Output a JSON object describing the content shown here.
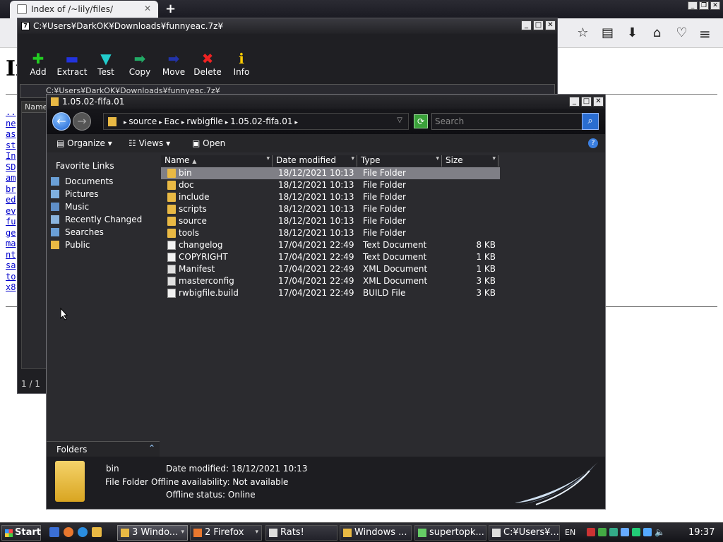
{
  "firefox": {
    "tab_title": "Index of /~lily/files/",
    "heading": "In",
    "links": [
      "..",
      "ne",
      "as",
      "st",
      "In",
      "SD",
      "am",
      "br",
      "ed",
      "ev",
      "fu",
      "ge",
      "ma",
      "nt",
      "sa",
      "to",
      "x8"
    ]
  },
  "zip": {
    "title": "C:¥Users¥DarkOK¥Downloads¥funnyeac.7z¥",
    "toolbar": [
      {
        "label": "Add",
        "icon": "plus-icon",
        "color": "#22cc22"
      },
      {
        "label": "Extract",
        "icon": "minus-icon",
        "color": "#2233dd"
      },
      {
        "label": "Test",
        "icon": "check-icon",
        "color": "#22cccc"
      },
      {
        "label": "Copy",
        "icon": "copy-arrow-icon",
        "color": "#22aa66"
      },
      {
        "label": "Move",
        "icon": "move-arrow-icon",
        "color": "#2233aa"
      },
      {
        "label": "Delete",
        "icon": "delete-x-icon",
        "color": "#ee2222"
      },
      {
        "label": "Info",
        "icon": "info-icon",
        "color": "#ffcc00"
      }
    ],
    "address": "C:¥Users¥DarkOK¥Downloads¥funnyeac.7z¥",
    "col_name": "Name",
    "status": "1 / 1"
  },
  "explorer": {
    "title": "1.05.02-fifa.01",
    "breadcrumb": [
      "source",
      "Eac",
      "rwbigfile",
      "1.05.02-fifa.01"
    ],
    "search_placeholder": "Search",
    "commands": {
      "organize": "Organize",
      "views": "Views",
      "open": "Open"
    },
    "favorites_title": "Favorite Links",
    "favorites": [
      "Documents",
      "Pictures",
      "Music",
      "Recently Changed",
      "Searches",
      "Public"
    ],
    "folders_label": "Folders",
    "columns": {
      "name": "Name",
      "date": "Date modified",
      "type": "Type",
      "size": "Size"
    },
    "files": [
      {
        "name": "bin",
        "date": "18/12/2021 10:13",
        "type": "File Folder",
        "size": "",
        "icon": "folder"
      },
      {
        "name": "doc",
        "date": "18/12/2021 10:13",
        "type": "File Folder",
        "size": "",
        "icon": "folder"
      },
      {
        "name": "include",
        "date": "18/12/2021 10:13",
        "type": "File Folder",
        "size": "",
        "icon": "folder"
      },
      {
        "name": "scripts",
        "date": "18/12/2021 10:13",
        "type": "File Folder",
        "size": "",
        "icon": "folder"
      },
      {
        "name": "source",
        "date": "18/12/2021 10:13",
        "type": "File Folder",
        "size": "",
        "icon": "folder"
      },
      {
        "name": "tools",
        "date": "18/12/2021 10:13",
        "type": "File Folder",
        "size": "",
        "icon": "folder"
      },
      {
        "name": "changelog",
        "date": "17/04/2021 22:49",
        "type": "Text Document",
        "size": "8 KB",
        "icon": "doc"
      },
      {
        "name": "COPYRIGHT",
        "date": "17/04/2021 22:49",
        "type": "Text Document",
        "size": "1 KB",
        "icon": "doc"
      },
      {
        "name": "Manifest",
        "date": "17/04/2021 22:49",
        "type": "XML Document",
        "size": "1 KB",
        "icon": "xml"
      },
      {
        "name": "masterconfig",
        "date": "17/04/2021 22:49",
        "type": "XML Document",
        "size": "3 KB",
        "icon": "xml"
      },
      {
        "name": "rwbigfile.build",
        "date": "17/04/2021 22:49",
        "type": "BUILD File",
        "size": "3 KB",
        "icon": "doc"
      }
    ],
    "selected_index": 0,
    "details": {
      "name": "bin",
      "type": "File Folder",
      "modified": "Date modified: 18/12/2021 10:13",
      "offline": "Offline availability: Not available",
      "status": "Offline status: Online"
    }
  },
  "taskbar": {
    "start": "Start",
    "buttons": [
      {
        "label": "3 Windo...",
        "active": true
      },
      {
        "label": "2 Firefox",
        "active": false
      },
      {
        "label": "Rats!",
        "active": false
      },
      {
        "label": "Windows ...",
        "active": false
      },
      {
        "label": "supertopk...",
        "active": false
      },
      {
        "label": "C:¥Users¥...",
        "active": false
      }
    ],
    "language": "EN",
    "clock": "19:37"
  }
}
